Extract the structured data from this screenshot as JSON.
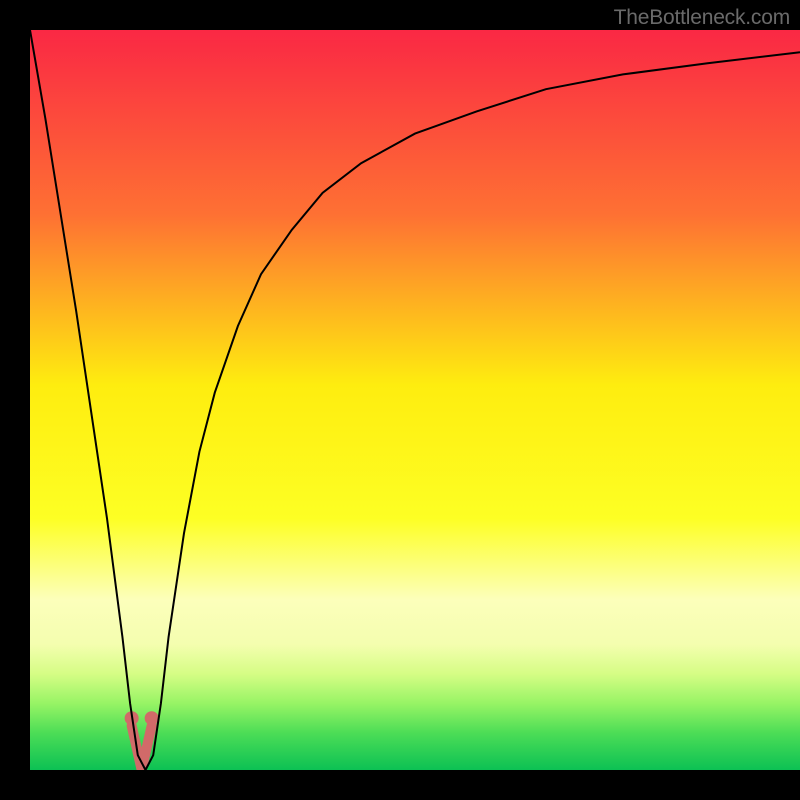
{
  "watermark": "TheBottleneck.com",
  "chart_data": {
    "type": "line",
    "title": "",
    "xlabel": "",
    "ylabel": "",
    "xlim": [
      0,
      100
    ],
    "ylim": [
      0,
      100
    ],
    "series": [
      {
        "name": "bottleneck-curve",
        "x": [
          0,
          2,
          4,
          6,
          8,
          10,
          12,
          13,
          14,
          15,
          16,
          17,
          18,
          20,
          22,
          24,
          27,
          30,
          34,
          38,
          43,
          50,
          58,
          67,
          77,
          88,
          100
        ],
        "y": [
          100,
          88,
          75,
          62,
          48,
          34,
          18,
          9,
          2,
          0,
          2,
          9,
          18,
          32,
          43,
          51,
          60,
          67,
          73,
          78,
          82,
          86,
          89,
          92,
          94,
          95.5,
          97
        ]
      }
    ],
    "markers": {
      "name": "data-points",
      "x": [
        13.2,
        15.8
      ],
      "y": [
        7.0,
        7.0
      ],
      "color": "#d16a69",
      "radius": 7
    },
    "notch": {
      "name": "notch-shape",
      "center_x": 14.5,
      "top_y": 6.0,
      "bottom_y": 0.0,
      "half_width": 1.3,
      "color": "#d16a69"
    },
    "gradient_colors": {
      "c0": "#fa2844",
      "c25": "#fe7133",
      "c48": "#feed0f",
      "c66": "#fdff24",
      "c77": "#fcffbb",
      "c83": "#f4feaf",
      "c87": "#d6fd85",
      "c91": "#97f465",
      "c95": "#4cdd56",
      "c100": "#0cc154"
    }
  }
}
